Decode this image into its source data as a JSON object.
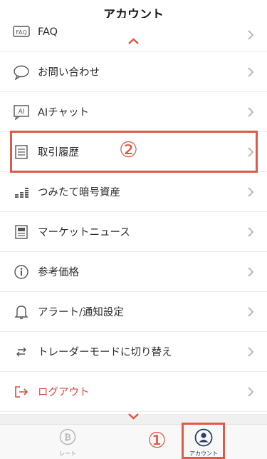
{
  "header": {
    "title": "アカウント"
  },
  "menu": {
    "items": [
      {
        "label": "FAQ",
        "icon": "faq-icon"
      },
      {
        "label": "お問い合わせ",
        "icon": "chat-bubble-icon"
      },
      {
        "label": "AIチャット",
        "icon": "ai-chat-icon"
      },
      {
        "label": "取引履歴",
        "icon": "document-list-icon"
      },
      {
        "label": "つみたて暗号資産",
        "icon": "accumulation-bars-icon"
      },
      {
        "label": "マーケットニュース",
        "icon": "newspaper-icon"
      },
      {
        "label": "参考価格",
        "icon": "info-icon"
      },
      {
        "label": "アラート/通知設定",
        "icon": "bell-icon"
      },
      {
        "label": "トレーダーモードに切り替え",
        "icon": "switch-arrows-icon"
      },
      {
        "label": "ログアウト",
        "icon": "logout-icon"
      }
    ]
  },
  "annotations": {
    "step1": "①",
    "step2": "②"
  },
  "tabbar": {
    "tabs": [
      {
        "label": "レート",
        "icon": "bitcoin-icon",
        "active": false
      },
      {
        "label": "アカウント",
        "icon": "account-icon",
        "active": true
      }
    ]
  },
  "colors": {
    "accent": "#e0533f",
    "logout": "#d9493c",
    "active_tab": "#2c3e62",
    "chevron": "#b0b0b0"
  }
}
